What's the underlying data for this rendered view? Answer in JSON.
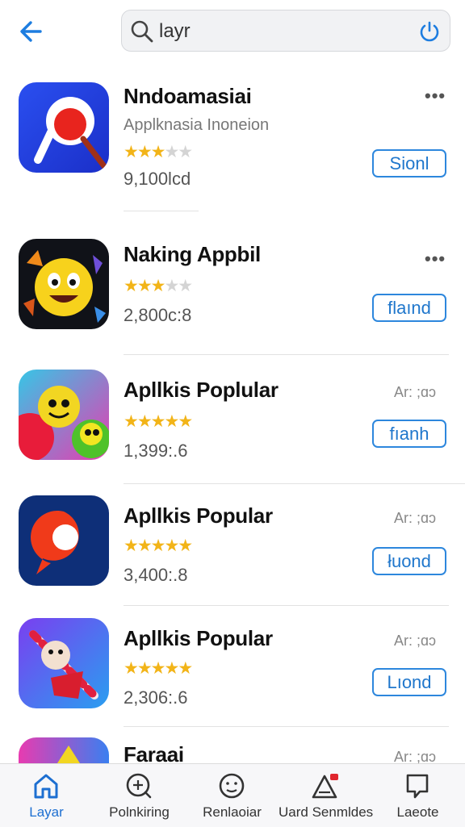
{
  "search": {
    "query": "layr"
  },
  "apps": [
    {
      "name": "Nndoamasiai",
      "subtitle": "Applknasia Inoneion",
      "rating": 2.5,
      "count": "9,100lcd",
      "button": "Sionl",
      "more": "•••",
      "meta": ""
    },
    {
      "name": "Naking Appbil",
      "subtitle": "",
      "rating": 2.5,
      "count": "2,800c:8",
      "button": "flaınd",
      "more": "•••",
      "meta": ""
    },
    {
      "name": "Apllkis Poplular",
      "subtitle": "",
      "rating": 4.5,
      "count": "1,399:.6",
      "button": "fıanh",
      "more": "",
      "meta": "Ar: ;ɑɔ"
    },
    {
      "name": "Apllkis Popular",
      "subtitle": "",
      "rating": 4.5,
      "count": "3,400:.8",
      "button": "łuond",
      "more": "",
      "meta": "Ar: ;ɑɔ"
    },
    {
      "name": "Apllkis Popular",
      "subtitle": "",
      "rating": 4.5,
      "count": "2,306:.6",
      "button": "Lıond",
      "more": "",
      "meta": "Ar: ;ɑɔ"
    },
    {
      "name": "Faraai",
      "subtitle": "",
      "rating": 0,
      "count": "",
      "button": "",
      "more": "",
      "meta": "Ar: ;ɑɔ"
    }
  ],
  "tabs": [
    {
      "label": "Layar",
      "icon": "home-icon",
      "active": true
    },
    {
      "label": "Polnkiring",
      "icon": "explore-icon",
      "active": false
    },
    {
      "label": "Renlaoiar",
      "icon": "smiley-icon",
      "active": false
    },
    {
      "label": "Uard Senmldes",
      "icon": "updates-icon",
      "active": false
    },
    {
      "label": "Laeote",
      "icon": "chat-icon",
      "active": false
    }
  ],
  "colors": {
    "accent": "#1d6fd1",
    "star": "#f2b418"
  }
}
